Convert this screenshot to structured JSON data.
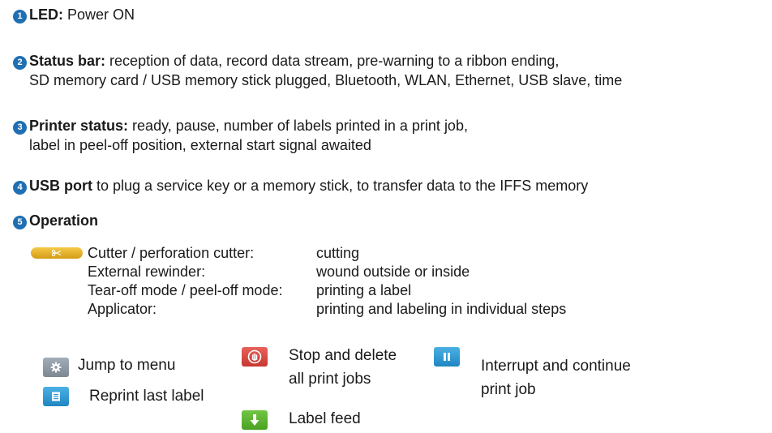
{
  "colors": {
    "badge": "#1f6fb2",
    "cutter": "#e5b02a",
    "menu": "#8c98a4",
    "reprint": "#2d9ad3",
    "stop": "#d94a43",
    "pause": "#2d9ad3",
    "feed": "#5bb431"
  },
  "items": [
    {
      "num": "1",
      "title": "LED:",
      "text": "Power ON"
    },
    {
      "num": "2",
      "title": "Status bar:",
      "text": "reception of data, record data stream, pre-warning to a ribbon ending,",
      "text2": "SD memory card / USB memory stick plugged, Bluetooth, WLAN, Ethernet, USB slave, time"
    },
    {
      "num": "3",
      "title": "Printer status:",
      "text": "ready, pause, number of labels printed in a print job,",
      "text2": "label in peel-off position, external start signal awaited"
    },
    {
      "num": "4",
      "title": "USB port",
      "text": "to plug a service key or a memory stick, to transfer data to the IFFS memory"
    },
    {
      "num": "5",
      "title": "Operation",
      "text": ""
    }
  ],
  "operation": [
    {
      "key": "Cutter / perforation cutter:",
      "value": "cutting"
    },
    {
      "key": "External rewinder:",
      "value": "wound outside or inside"
    },
    {
      "key": "Tear-off mode / peel-off mode:",
      "value": "printing a label"
    },
    {
      "key": "Applicator:",
      "value": "printing and labeling in individual steps"
    }
  ],
  "buttons": {
    "cutter_icon": "scissors-icon",
    "menu": {
      "icon": "gear-icon",
      "label": "Jump to menu"
    },
    "reprint": {
      "icon": "printer-icon",
      "label": "Reprint last label"
    },
    "stop": {
      "icon": "stop-hand-icon",
      "label1": "Stop and delete",
      "label2": "all print jobs"
    },
    "pause": {
      "icon": "pause-icon",
      "label1": "Interrupt and continue",
      "label2": "print job"
    },
    "feed": {
      "icon": "arrow-down-icon",
      "label": "Label feed"
    }
  }
}
